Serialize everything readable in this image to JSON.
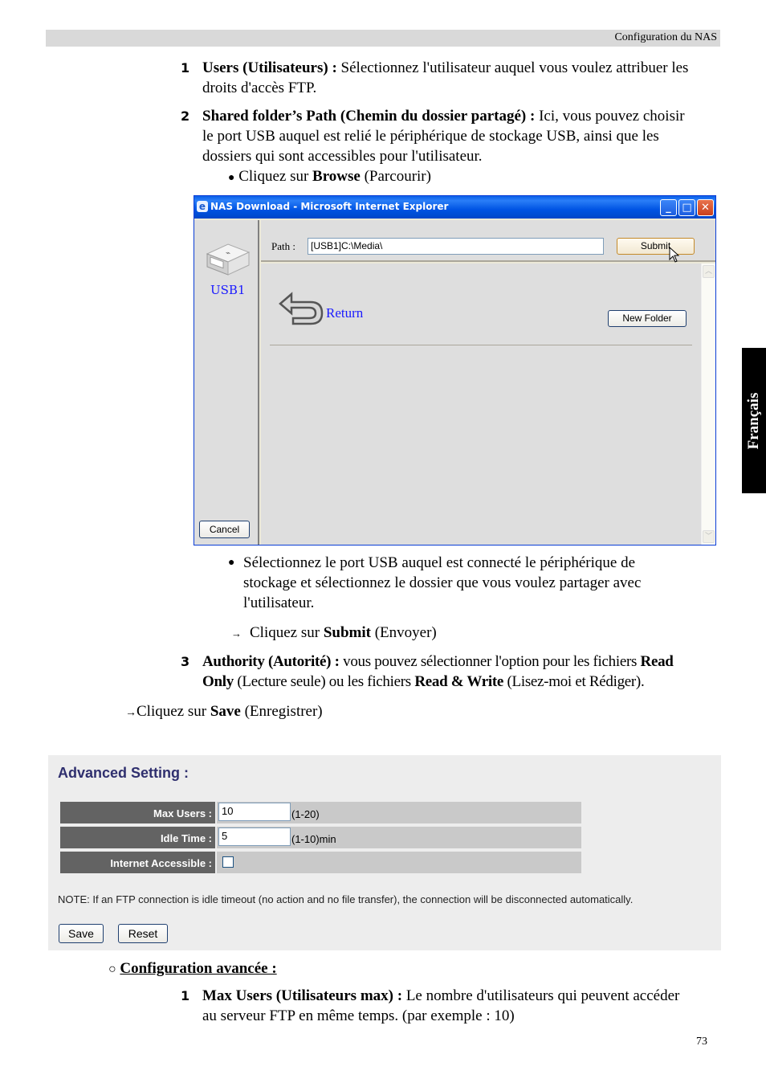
{
  "header": {
    "section_title": "Configuration du NAS"
  },
  "side_tab": {
    "language": "Français"
  },
  "items": {
    "item1": {
      "number": "1",
      "bold": "Users (Utilisateurs) :",
      "text_line1": " Sélectionnez l'utilisateur auquel vous voulez attribuer les",
      "text_line2": "droits d'accès FTP."
    },
    "item2": {
      "number": "2",
      "bold": "Shared folder’s Path (Chemin du dossier partagé) :",
      "text_line1": " Ici, vous pouvez choisir",
      "text_line2": "le port USB auquel est relié le périphérique de stockage USB, ainsi que les",
      "text_line3": "dossiers qui sont accessibles pour l'utilisateur."
    },
    "bullet_browse": {
      "bullet": "●",
      "prefix": "Cliquez sur ",
      "bold": "Browse",
      "suffix": " (Parcourir)"
    },
    "bullet_select": {
      "bullet": "●",
      "line1": "Sélectionnez le port USB auquel est connecté le périphérique de",
      "line2": "stockage et sélectionnez le dossier que vous voulez partager avec",
      "line3": "l'utilisateur."
    },
    "arrow_submit": {
      "arrow": "→",
      "prefix": "Cliquez sur ",
      "bold": "Submit",
      "suffix": " (Envoyer)"
    },
    "item3": {
      "number": "3",
      "bold": "Authority (Autorité) :",
      "text_line1": " vous pouvez sélectionner l'option pour les fichiers ",
      "bold2": "Read",
      "bold3": "Only",
      "text_line2a": " (Lecture seule) ou les fichiers ",
      "bold4": "Read & Write",
      "text_line2b": " (Lisez-moi et Rédiger)."
    },
    "arrow_save": {
      "arrow": "→",
      "prefix": "Cliquez sur ",
      "bold": "Save",
      "suffix": " (Enregistrer)"
    }
  },
  "ie_window": {
    "title": "NAS Download - Microsoft Internet Explorer",
    "logo": "e",
    "controls": {
      "minimize": "_",
      "maximize": "□",
      "close": "✕"
    },
    "usb_label": "USB1",
    "path_label": "Path :",
    "path_value": "[USB1]C:\\Media\\",
    "submit_label": "Submit",
    "return_label": "Return",
    "new_folder_label": "New Folder",
    "cancel_label": "Cancel",
    "scroll_up": "︿",
    "scroll_down": "﹀"
  },
  "advanced_setting": {
    "title": "Advanced Setting  :",
    "rows": [
      {
        "label": "Max Users :",
        "value": "10",
        "hint": "(1-20)"
      },
      {
        "label": "Idle Time :",
        "value": "5",
        "hint": "(1-10)min"
      },
      {
        "label": "Internet Accessible :",
        "checked": false
      }
    ],
    "note": "NOTE: If an FTP connection is idle timeout (no action and no file transfer), the connection will be disconnected automatically.",
    "save_label": "Save",
    "reset_label": "Reset"
  },
  "config_avancee": {
    "marker": "○",
    "heading": "Configuration avancée :",
    "item1": {
      "number": "1",
      "bold": "Max Users (Utilisateurs max) :",
      "text_line1": " Le nombre d'utilisateurs qui peuvent accéder",
      "text_line2": "au serveur FTP en même temps. (par exemple : 10)"
    }
  },
  "footer": {
    "page_number": "73"
  }
}
